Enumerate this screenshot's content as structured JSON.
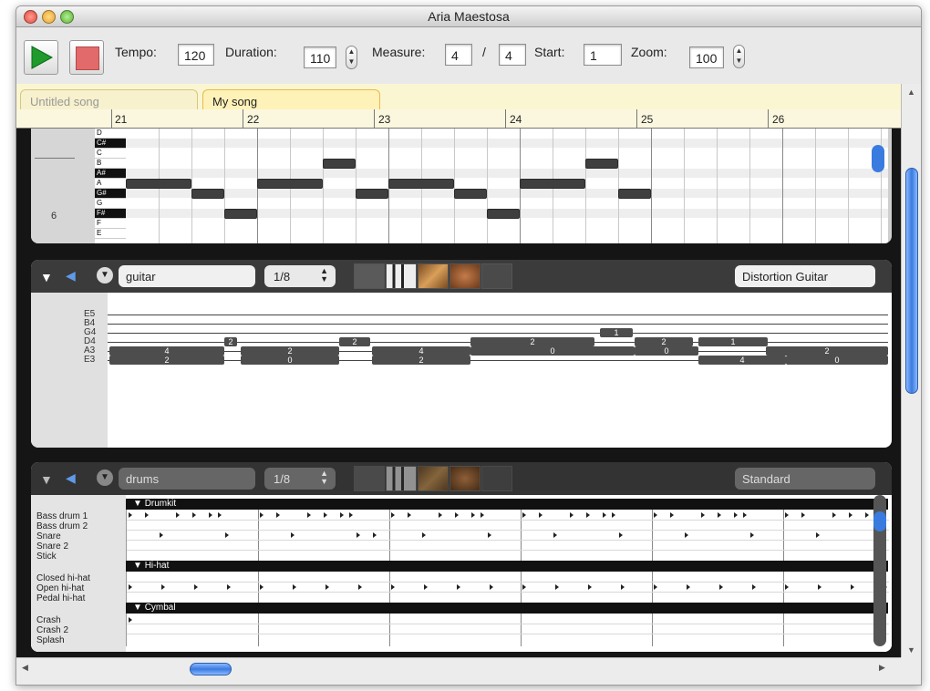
{
  "window": {
    "title": "Aria Maestosa"
  },
  "toolbar": {
    "tempo_label": "Tempo:",
    "tempo_value": "120",
    "duration_label": "Duration:",
    "duration_value": "110",
    "measure_label": "Measure:",
    "measure_num": "4",
    "measure_sep": "/",
    "measure_den": "4",
    "start_label": "Start:",
    "start_value": "1",
    "zoom_label": "Zoom:",
    "zoom_value": "100"
  },
  "tabs": [
    {
      "label": "Untitled song",
      "active": false
    },
    {
      "label": "My song",
      "active": true
    }
  ],
  "ruler": {
    "measures": [
      "21",
      "22",
      "23",
      "24",
      "25",
      "26"
    ]
  },
  "piano": {
    "keys": [
      {
        "name": "D",
        "black": false
      },
      {
        "name": "C#",
        "black": true
      },
      {
        "name": "C",
        "black": false
      },
      {
        "name": "B",
        "black": false
      },
      {
        "name": "A#",
        "black": true
      },
      {
        "name": "A",
        "black": false
      },
      {
        "name": "G#",
        "black": true
      },
      {
        "name": "G",
        "black": false
      },
      {
        "name": "F#",
        "black": true
      },
      {
        "name": "F",
        "black": false
      },
      {
        "name": "E",
        "black": false
      }
    ],
    "octave_label": "6"
  },
  "guitar_track": {
    "name": "guitar",
    "grid": "1/8",
    "instrument": "Distortion Guitar",
    "strings": [
      "E5",
      "B4",
      "G4",
      "D4",
      "A3",
      "E3"
    ],
    "frets": [
      "2",
      "4",
      "0",
      "1"
    ]
  },
  "drum_track": {
    "name": "drums",
    "grid": "1/8",
    "instrument": "Standard",
    "sections": [
      {
        "name": "Drumkit",
        "rows": [
          "Bass drum 1",
          "Bass drum 2",
          "Snare",
          "Snare 2",
          "Stick"
        ]
      },
      {
        "name": "Hi-hat",
        "rows": [
          "Closed hi-hat",
          "Open hi-hat",
          "Pedal hi-hat"
        ]
      },
      {
        "name": "Cymbal",
        "rows": [
          "Crash",
          "Crash 2",
          "Splash"
        ]
      }
    ]
  },
  "icons": {
    "collapse": "collapse-triangle-icon",
    "speaker": "speaker-icon",
    "menu": "menu-circle-icon"
  },
  "colors": {
    "play": "#1f9a2b",
    "stop": "#e36a6a",
    "tab_bg": "#fbf6d2",
    "note": "#3f3f3f",
    "scroll": "#3a7be0"
  }
}
